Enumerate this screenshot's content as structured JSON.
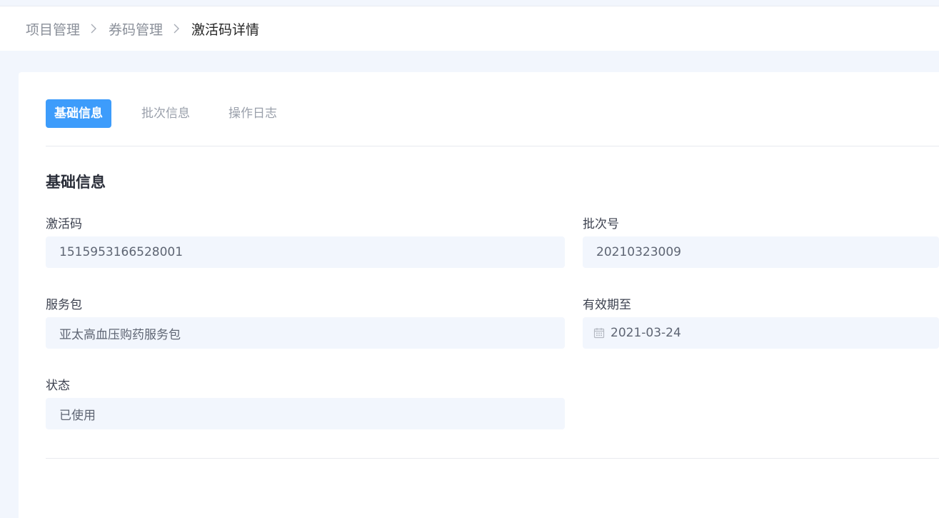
{
  "breadcrumb": {
    "items": [
      "项目管理",
      "券码管理",
      "激活码详情"
    ]
  },
  "tabs": [
    {
      "label": "基础信息",
      "active": true
    },
    {
      "label": "批次信息",
      "active": false
    },
    {
      "label": "操作日志",
      "active": false
    }
  ],
  "section": {
    "title": "基础信息"
  },
  "fields": {
    "activation_code": {
      "label": "激活码",
      "value": "1515953166528001"
    },
    "batch_no": {
      "label": "批次号",
      "value": "20210323009"
    },
    "service_package": {
      "label": "服务包",
      "value": "亚太高血压购药服务包"
    },
    "valid_until": {
      "label": "有效期至",
      "value": "2021-03-24",
      "icon": "calendar-icon"
    },
    "status": {
      "label": "状态",
      "value": "已使用"
    }
  },
  "colors": {
    "accent": "#3d9cfb",
    "page_bg": "#f2f6fd",
    "field_bg": "#f2f6fd"
  }
}
